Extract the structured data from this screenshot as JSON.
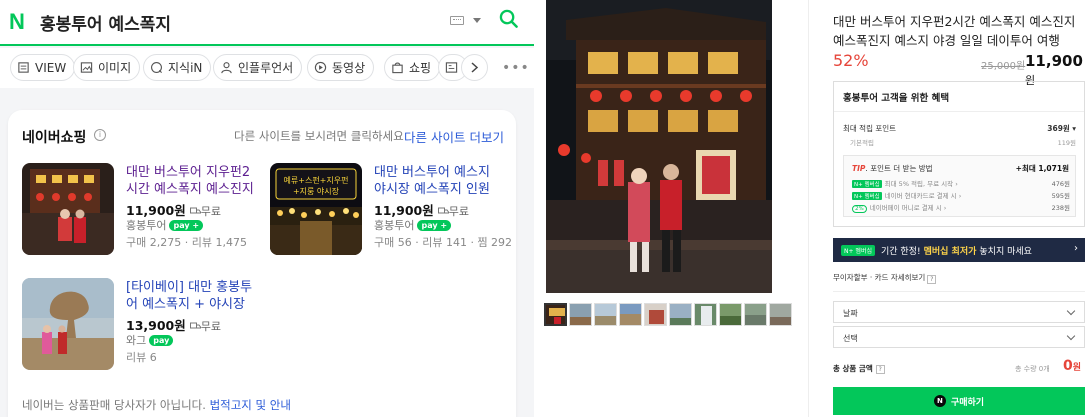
{
  "search": {
    "logo": "N",
    "query": "홍봉투어 예스폭지"
  },
  "tabs": [
    {
      "label": "VIEW",
      "icon": "view-icon"
    },
    {
      "label": "이미지",
      "icon": "image-icon"
    },
    {
      "label": "지식iN",
      "icon": "qna-icon"
    },
    {
      "label": "인플루언서",
      "icon": "person-icon"
    },
    {
      "label": "동영상",
      "icon": "play-icon"
    },
    {
      "label": "쇼핑",
      "icon": "bag-icon"
    },
    {
      "label": "",
      "icon": "news-icon"
    }
  ],
  "shopping": {
    "title": "네이버쇼핑",
    "hint": "다른 사이트를 보시려면 클릭하세요",
    "more": "다른 사이트 더보기",
    "footer_text": "네이버는 상품판매 당사자가 아닙니다.",
    "footer_link": "법적고지 및 안내",
    "products": [
      {
        "name": "대만 버스투어 지우펀2시간 예스폭지 예스진지",
        "price": "11,900원",
        "ship": "무료",
        "seller": "홍봉투어",
        "stats": "구매 2,275 · 리뷰 1,475"
      },
      {
        "name": "대만 버스투어 예스지 야시장 예스폭지 인원",
        "price": "11,900원",
        "ship": "무료",
        "seller": "홍봉투어",
        "stats": "구매 56 · 리뷰 141 · 찜 292",
        "banner_text": [
          "예류+스펀+지우펀",
          "+지룽 야시장"
        ]
      },
      {
        "name": "[타이베이] 대만 홍봉투어 예스폭지 + 야시장",
        "price": "13,900원",
        "ship": "무료",
        "seller": "와그",
        "stats": "리뷰 6"
      }
    ],
    "pay_label": "pay"
  },
  "product": {
    "title": "대만 버스투어 지우펀2시간 예스폭지 예스진지 예스폭진지 예스지 야경 일일 데이투어 여행",
    "discount": "52%",
    "original_price": "25,000원",
    "sale_price": "11,900",
    "sale_unit": "원",
    "benefit": {
      "title": "홍봉투어 고객을 위한 혜택",
      "points_label": "최대 적립 포인트",
      "points_value": "369원",
      "basic_label": "기본적립",
      "basic_value": "119원",
      "tip_label": "TIP",
      "tip_text": "포인트 더 받는 방법",
      "tip_max": "+최대 1,071원",
      "rows": [
        {
          "chip": "N+ 멤버십",
          "text": "최대 5% 적립, 무료 시작",
          "value": "476원"
        },
        {
          "chip": "N+ 멤버십",
          "text": "네이버 현대카드로 결제 시",
          "value": "595원"
        },
        {
          "chip2": "2%",
          "text": "네이버페이 머니로 결제 시",
          "value": "238원"
        }
      ]
    },
    "member_banner": {
      "chip": "N+ 멤버십",
      "pre": "기간 한정!",
      "em": "멤버십 최저가",
      "post": "놓치지 마세요"
    },
    "pay_line": "무이자할부 · 카드 자세히보기",
    "pay_help": "?",
    "selects": [
      "날짜",
      "선택"
    ],
    "total_label": "총 상품 금액",
    "total_help": "?",
    "total_qty": "총 수량 0개",
    "total_amount": "0",
    "total_unit": "원",
    "buy_label": "구매하기",
    "buy_icon_text": "N"
  },
  "gallery_thumb_count": 10,
  "colors": {
    "naver_green": "#03c75a",
    "discount_red": "#e6453a",
    "link_blue": "#2d5cd8"
  }
}
